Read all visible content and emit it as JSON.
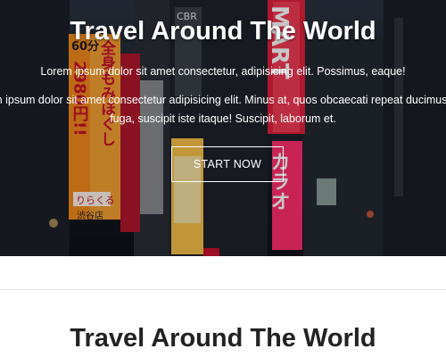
{
  "hero": {
    "title": "Travel Around The World",
    "line1": "Lorem ipsum dolor sit amet consectetur, adipisicing elit. Possimus, eaque!",
    "line2": "Lorem ipsum dolor sit amet consectetur adipisicing elit. Minus at, quos obcaecati repeat ducimus quod fuga, suscipit iste itaque! Suscipit, laborum et.",
    "button_label": "START NOW",
    "sign_text": {
      "left_top": "60分",
      "left_main": "全身もみほぐし",
      "left_price": "2980円!!",
      "left_sub": "りらくる",
      "left_sub2": "渋谷店",
      "mid_top": "CBR",
      "right_main": "MART",
      "right_sub": "カラオ"
    }
  },
  "section": {
    "title": "Travel Around The World"
  },
  "colors": {
    "hero_text": "#ffffff",
    "sign_orange": "#f28a1c",
    "sign_red": "#e0203a",
    "sign_pink": "#ff2f6e",
    "section_text": "#222222"
  }
}
